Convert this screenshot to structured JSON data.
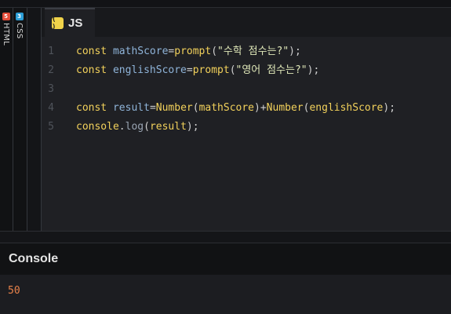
{
  "panels": {
    "html_tab": {
      "label": "HTML",
      "badge": "5",
      "icon": "html5-icon",
      "color": "#e44d3a"
    },
    "css_tab": {
      "label": "CSS",
      "badge": "3",
      "icon": "css3-icon",
      "color": "#2d9fd8"
    }
  },
  "editor": {
    "active_tab": {
      "label": "JS",
      "badge": "( )",
      "icon": "js-icon",
      "color": "#f0d34a"
    },
    "lines": [
      {
        "number": "1",
        "tokens": [
          {
            "t": "const ",
            "c": "kw"
          },
          {
            "t": "mathScore",
            "c": "var"
          },
          {
            "t": "=",
            "c": "punc"
          },
          {
            "t": "prompt",
            "c": "fn"
          },
          {
            "t": "(",
            "c": "punc"
          },
          {
            "t": "\"수학 점수는?\"",
            "c": "str"
          },
          {
            "t": ");",
            "c": "punc"
          }
        ]
      },
      {
        "number": "2",
        "tokens": [
          {
            "t": "const ",
            "c": "kw"
          },
          {
            "t": "englishScore",
            "c": "var"
          },
          {
            "t": "=",
            "c": "punc"
          },
          {
            "t": "prompt",
            "c": "fn"
          },
          {
            "t": "(",
            "c": "punc"
          },
          {
            "t": "\"영어 점수는?\"",
            "c": "str"
          },
          {
            "t": ");",
            "c": "punc"
          }
        ]
      },
      {
        "number": "3",
        "tokens": []
      },
      {
        "number": "4",
        "tokens": [
          {
            "t": "const ",
            "c": "kw"
          },
          {
            "t": "result",
            "c": "var"
          },
          {
            "t": "=",
            "c": "punc"
          },
          {
            "t": "Number",
            "c": "fn"
          },
          {
            "t": "(",
            "c": "punc"
          },
          {
            "t": "mathScore",
            "c": "kw"
          },
          {
            "t": ")+",
            "c": "punc"
          },
          {
            "t": "Number",
            "c": "fn"
          },
          {
            "t": "(",
            "c": "punc"
          },
          {
            "t": "englishScore",
            "c": "kw"
          },
          {
            "t": ");",
            "c": "punc"
          }
        ]
      },
      {
        "number": "5",
        "tokens": [
          {
            "t": "console",
            "c": "kw"
          },
          {
            "t": ".",
            "c": "punc"
          },
          {
            "t": "log",
            "c": "prop"
          },
          {
            "t": "(",
            "c": "punc"
          },
          {
            "t": "result",
            "c": "kw"
          },
          {
            "t": ");",
            "c": "punc"
          }
        ]
      }
    ]
  },
  "console": {
    "title": "Console",
    "output": "50"
  }
}
